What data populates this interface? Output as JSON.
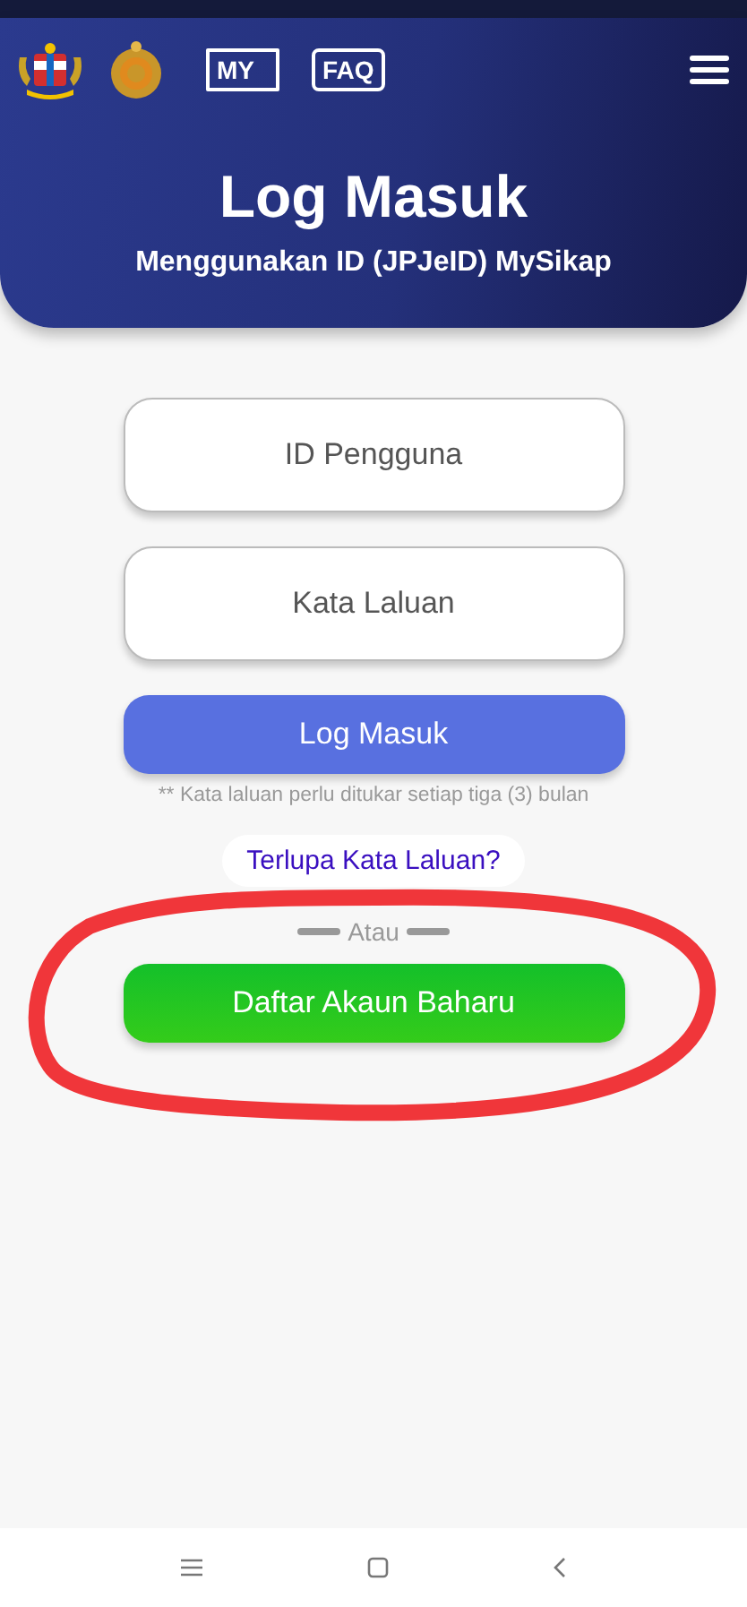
{
  "header": {
    "badges": [
      {
        "kind": "flag",
        "text": "MY"
      },
      {
        "kind": "bubble",
        "text": "FAQ"
      }
    ],
    "title": "Log Masuk",
    "subtitle": "Menggunakan ID (JPJeID) MySikap"
  },
  "form": {
    "fields": [
      {
        "placeholder": "ID Pengguna"
      },
      {
        "placeholder": "Kata Laluan"
      }
    ],
    "login_button": "Log Masuk",
    "note": "** Kata laluan perlu ditukar setiap tiga (3) bulan",
    "forgot_link": "Terlupa Kata Laluan?",
    "divider": "Atau",
    "register_button": "Daftar Akaun Baharu"
  }
}
